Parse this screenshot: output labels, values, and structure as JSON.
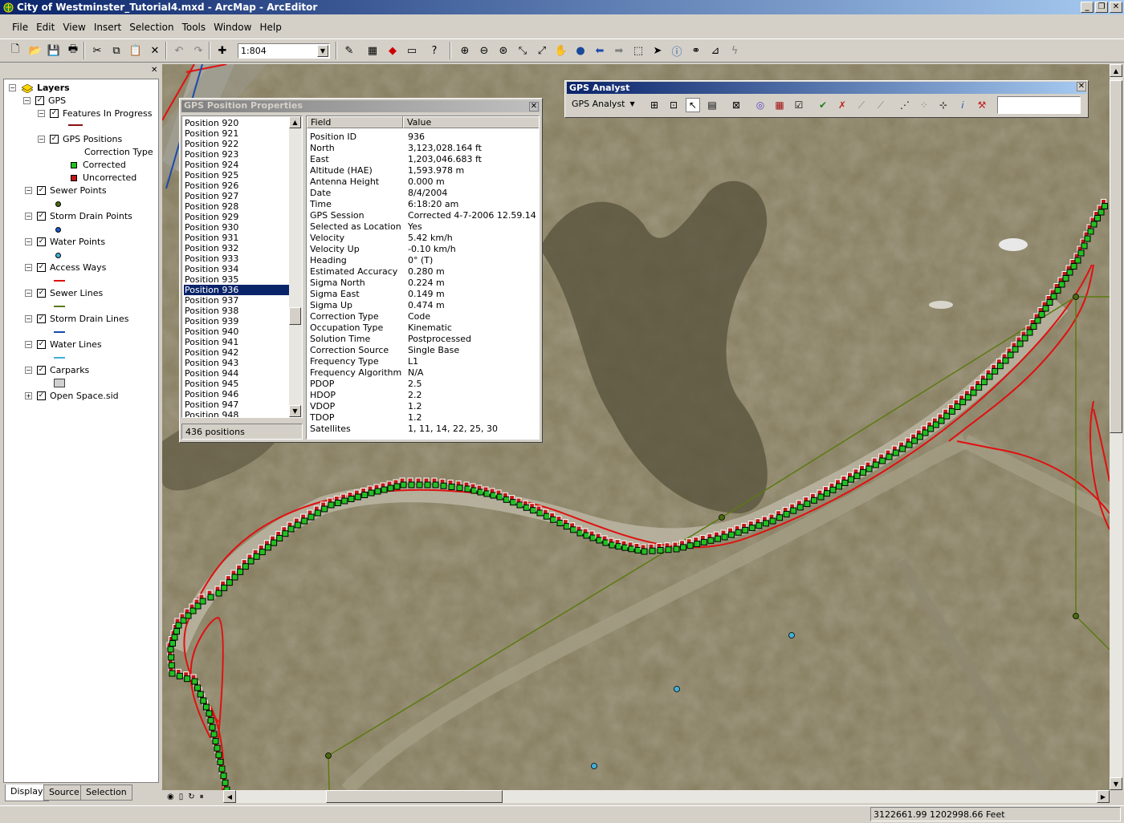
{
  "window": {
    "title": "City of Westminster_Tutorial4.mxd - ArcMap - ArcEditor"
  },
  "menu": [
    "File",
    "Edit",
    "View",
    "Insert",
    "Selection",
    "Tools",
    "Window",
    "Help"
  ],
  "toolbar": {
    "scale": "1:804"
  },
  "toc": {
    "layers_label": "Layers",
    "items": [
      {
        "label": "GPS"
      },
      {
        "label": "Features In Progress"
      },
      {
        "label": "GPS Positions"
      },
      {
        "label": "Correction Type"
      },
      {
        "label": "Corrected"
      },
      {
        "label": "Uncorrected"
      },
      {
        "label": "Sewer Points"
      },
      {
        "label": "Storm Drain Points"
      },
      {
        "label": "Water Points"
      },
      {
        "label": "Access Ways"
      },
      {
        "label": "Sewer Lines"
      },
      {
        "label": "Storm Drain Lines"
      },
      {
        "label": "Water Lines"
      },
      {
        "label": "Carparks"
      },
      {
        "label": "Open Space.sid"
      }
    ],
    "tabs": [
      "Display",
      "Source",
      "Selection"
    ]
  },
  "gps_props": {
    "title": "GPS Position Properties",
    "positions": [
      "Position 920",
      "Position 921",
      "Position 922",
      "Position 923",
      "Position 924",
      "Position 925",
      "Position 926",
      "Position 927",
      "Position 928",
      "Position 929",
      "Position 930",
      "Position 931",
      "Position 932",
      "Position 933",
      "Position 934",
      "Position 935",
      "Position 936",
      "Position 937",
      "Position 938",
      "Position 939",
      "Position 940",
      "Position 941",
      "Position 942",
      "Position 943",
      "Position 944",
      "Position 945",
      "Position 946",
      "Position 947",
      "Position 948"
    ],
    "selected_index": 16,
    "count": "436 positions",
    "headers": {
      "field": "Field",
      "value": "Value"
    },
    "rows": [
      {
        "field": "Position ID",
        "value": "936"
      },
      {
        "field": "North",
        "value": "3,123,028.164 ft"
      },
      {
        "field": "East",
        "value": "1,203,046.683 ft"
      },
      {
        "field": "Altitude (HAE)",
        "value": "1,593.978 m"
      },
      {
        "field": "Antenna Height",
        "value": "0.000 m"
      },
      {
        "field": "Date",
        "value": "8/4/2004"
      },
      {
        "field": "Time",
        "value": "6:18:20 am"
      },
      {
        "field": "GPS Session",
        "value": "Corrected 4-7-2006 12.59.14 ..."
      },
      {
        "field": "Selected as Location",
        "value": "Yes"
      },
      {
        "field": "Velocity",
        "value": "5.42 km/h"
      },
      {
        "field": "Velocity Up",
        "value": "-0.10 km/h"
      },
      {
        "field": "Heading",
        "value": "0° (T)"
      },
      {
        "field": "Estimated Accuracy",
        "value": "0.280 m"
      },
      {
        "field": "Sigma North",
        "value": "0.224 m"
      },
      {
        "field": "Sigma East",
        "value": "0.149 m"
      },
      {
        "field": "Sigma Up",
        "value": "0.474 m"
      },
      {
        "field": "Correction Type",
        "value": "Code"
      },
      {
        "field": "Occupation Type",
        "value": "Kinematic"
      },
      {
        "field": "Solution Time",
        "value": "Postprocessed"
      },
      {
        "field": "Correction Source",
        "value": "Single Base"
      },
      {
        "field": "Frequency Type",
        "value": "L1"
      },
      {
        "field": "Frequency Algorithm ...",
        "value": "N/A"
      },
      {
        "field": "PDOP",
        "value": "2.5"
      },
      {
        "field": "HDOP",
        "value": "2.2"
      },
      {
        "field": "VDOP",
        "value": "1.2"
      },
      {
        "field": "TDOP",
        "value": "1.2"
      },
      {
        "field": "Satellites",
        "value": "1, 11, 14, 22, 25, 30"
      }
    ]
  },
  "gps_analyst": {
    "title": "GPS Analyst",
    "dropdown": "GPS Analyst"
  },
  "status": {
    "coordinates": "3122661.99  1202998.66 Feet"
  },
  "colors": {
    "corrected": "#22c022",
    "uncorrected": "#c01818",
    "access_way": "#e01010",
    "sewer_line": "#5a7a10",
    "water": "#40b0d8"
  }
}
